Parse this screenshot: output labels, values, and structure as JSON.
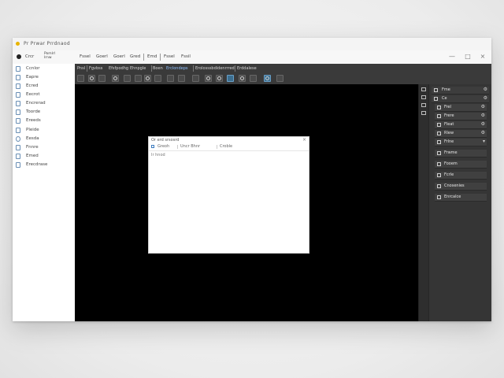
{
  "window": {
    "title": "Pr  Prwar  Prrdnaod"
  },
  "menu": {
    "items": [
      "Crcr",
      "Pomlrl\nlrnw",
      "Fssel",
      "Goerl",
      "Goerl",
      "Gred",
      "Emd",
      "Fssel",
      "Fssil"
    ],
    "close_glyph": "×",
    "minimize_glyph": "—",
    "maximize_glyph": "□"
  },
  "sidebar": {
    "items": [
      {
        "label": "Ccnlor"
      },
      {
        "label": "Eapre"
      },
      {
        "label": "Ecred"
      },
      {
        "label": "Eecrot"
      },
      {
        "label": "Encrerad"
      },
      {
        "label": "Toorde"
      },
      {
        "label": "Ereeds"
      },
      {
        "label": "Pleide"
      },
      {
        "label": "Eesda"
      },
      {
        "label": "Fnnre"
      },
      {
        "label": "Emed"
      },
      {
        "label": "Erecdrase"
      }
    ]
  },
  "toolbar": {
    "tabs": [
      "Pnsl",
      "Fgvbss",
      "Efsfpodhg",
      "Ehnpgle",
      "Boen",
      "Erclondeps",
      "Erolosssbdidenrrred",
      "Erddalese"
    ]
  },
  "document": {
    "title": "Or  erd  srsosrd",
    "toolbar_items": [
      "Greoh",
      "Uncr  Bhnr",
      "Croble"
    ],
    "body_line": "Ir  hnod",
    "close_glyph": "×"
  },
  "right_panel": {
    "rows": [
      {
        "label": "Fme",
        "gear": "⚙"
      },
      {
        "label": "Ce",
        "gear": "⚙"
      },
      {
        "label": "Frel",
        "gear": "⚙"
      },
      {
        "label": "Frere",
        "gear": "⚙"
      },
      {
        "label": "Fleat",
        "gear": "⚙"
      },
      {
        "label": "Rlew",
        "gear": "⚙"
      },
      {
        "label": "Frlne",
        "gear": "▾"
      }
    ],
    "sub_rows": [
      {
        "label": "Frwme"
      },
      {
        "label": "Fooem"
      },
      {
        "label": "Fcrle"
      },
      {
        "label": "Cnosenies"
      },
      {
        "label": "Enrcalce"
      }
    ]
  },
  "colors": {
    "accent": "#3c6e8f",
    "app_dot": "#e8b400",
    "canvas": "#000000",
    "panel_dark": "#353535"
  }
}
